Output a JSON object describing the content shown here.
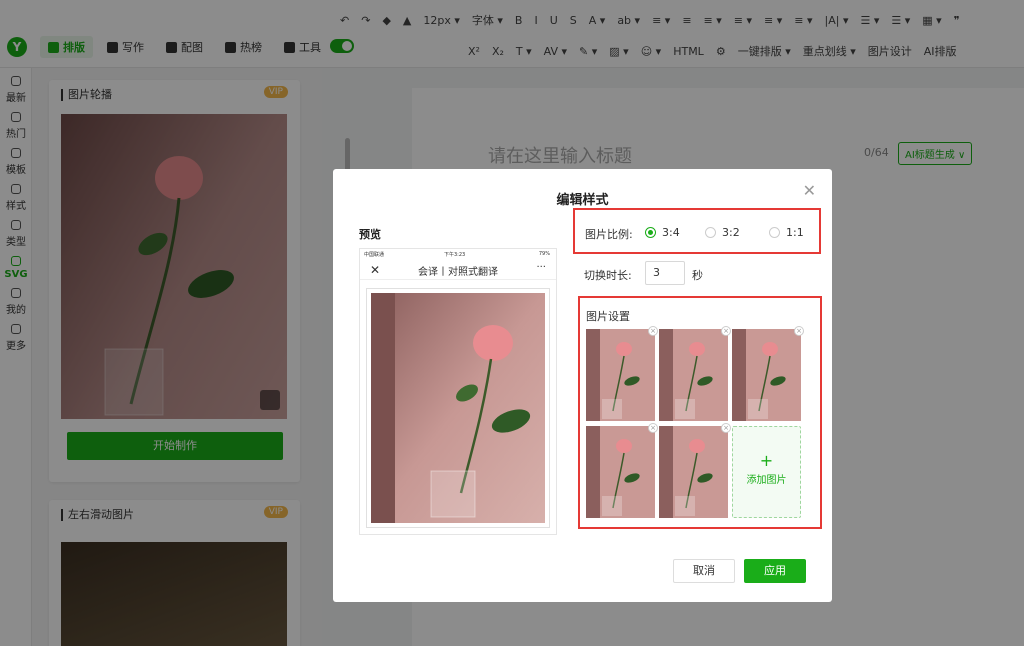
{
  "toolbar": {
    "row1": [
      "↶",
      "↷",
      "◆",
      "▲",
      "12px ▾",
      "字体 ▾",
      "B",
      "I",
      "U",
      "S",
      "A ▾",
      "ab ▾",
      "≡ ▾",
      "≡",
      "≡ ▾",
      "≡ ▾",
      "≡ ▾",
      "≡ ▾",
      "|A| ▾",
      "☰ ▾",
      "☰ ▾",
      "▦ ▾",
      "❞"
    ],
    "row2": [
      "X²",
      "X₂",
      "T ▾",
      "AV ▾",
      "✎ ▾",
      "▨ ▾",
      "☺ ▾",
      "HTML",
      "⚙",
      "一键排版 ▾",
      "重点划线 ▾",
      "图片设计",
      "AI排版"
    ]
  },
  "nav": {
    "logo": "Y",
    "tabs": [
      "排版",
      "写作",
      "配图",
      "热榜",
      "工具"
    ]
  },
  "leftbar": [
    "最新",
    "热门",
    "模板",
    "样式",
    "类型",
    "SVG",
    "我的",
    "更多"
  ],
  "panel": {
    "card1_title": "图片轮播",
    "card1_vip": "VIP",
    "start_button": "开始制作",
    "card2_title": "左右滑动图片",
    "card2_vip": "VIP"
  },
  "editor": {
    "title_placeholder": "请在这里输入标题",
    "count": "0/64",
    "ai_title": "AI标题生成 ∨"
  },
  "modal": {
    "title": "编辑样式",
    "close": "✕",
    "preview_label": "预览",
    "phone": {
      "carrier": "中国联通",
      "time": "下午3:23",
      "battery": "79%",
      "title": "会译丨对照式翻译",
      "close": "✕",
      "more": "···"
    },
    "ratio_label": "图片比例:",
    "ratios": [
      {
        "label": "3:4",
        "selected": true
      },
      {
        "label": "3:2",
        "selected": false
      },
      {
        "label": "1:1",
        "selected": false
      }
    ],
    "duration_label": "切换时长:",
    "duration_value": "3",
    "duration_unit": "秒",
    "images_label": "图片设置",
    "image_count": 5,
    "add_image_label": "添加图片",
    "cancel": "取消",
    "apply": "应用"
  },
  "colors": {
    "brand": "#1aad19",
    "highlight": "#e53935"
  }
}
